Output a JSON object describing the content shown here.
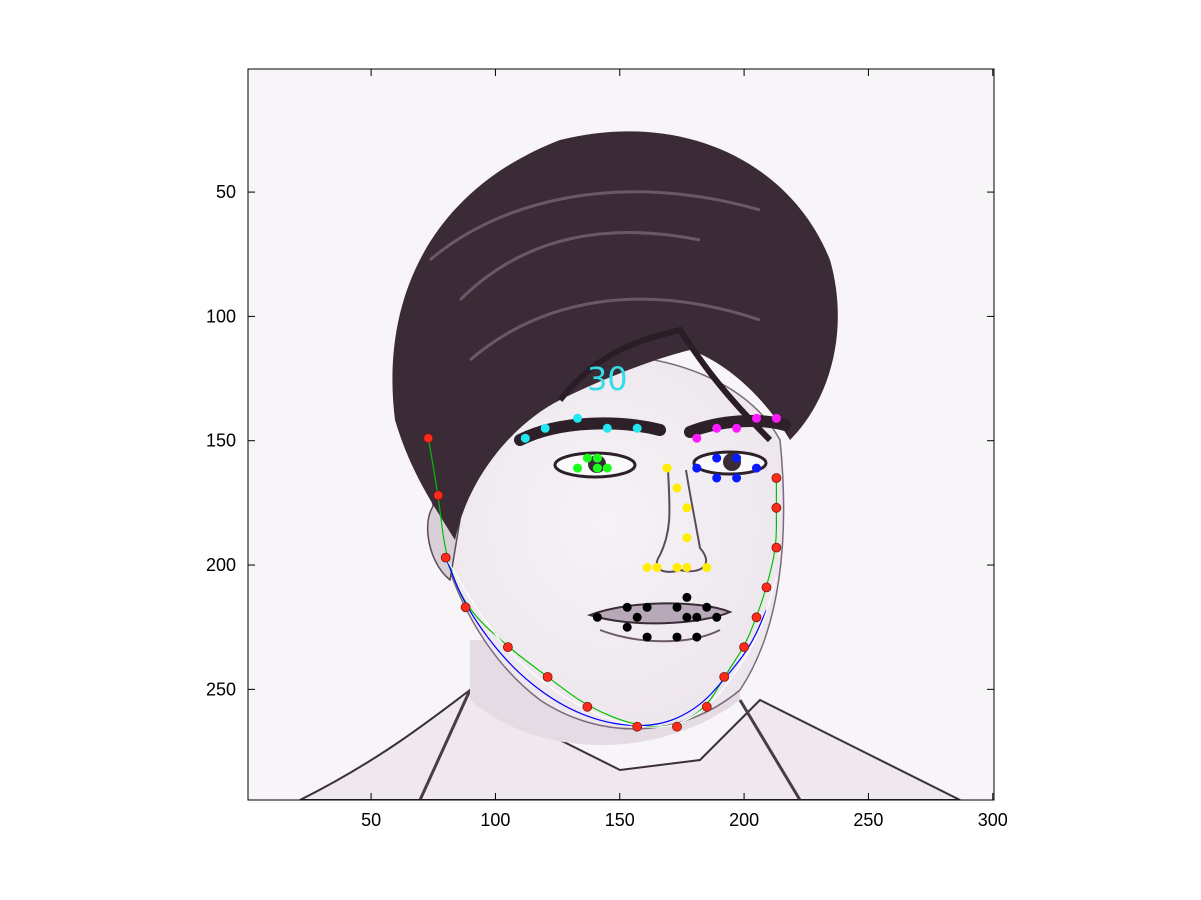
{
  "chart_data": {
    "type": "scatter",
    "title": "",
    "xlabel": "",
    "ylabel": "",
    "xlim": [
      0.5,
      300.5
    ],
    "ylim": [
      0.5,
      294.5
    ],
    "y_reversed": true,
    "grid": false,
    "x_ticks": [
      50,
      100,
      150,
      200,
      250,
      300
    ],
    "y_ticks": [
      50,
      100,
      150,
      200,
      250
    ],
    "background": "grayscale face sketch image",
    "annotations": [
      {
        "text": "30",
        "x": 145,
        "y": 126,
        "color": "#33dde6"
      }
    ],
    "series": [
      {
        "color": "#ff2a1a",
        "points": [
          [
            73,
            149
          ],
          [
            77,
            172
          ],
          [
            80,
            197
          ],
          [
            88,
            217
          ],
          [
            105,
            233
          ],
          [
            121,
            245
          ],
          [
            137,
            257
          ],
          [
            157,
            265
          ],
          [
            173,
            265
          ],
          [
            185,
            257
          ],
          [
            192,
            245
          ],
          [
            200,
            233
          ],
          [
            205,
            221
          ],
          [
            209,
            209
          ],
          [
            213,
            193
          ],
          [
            213,
            177
          ],
          [
            213,
            165
          ]
        ]
      },
      {
        "color": "#22e6f0",
        "points": [
          [
            112,
            149
          ],
          [
            120,
            145
          ],
          [
            133,
            141
          ],
          [
            145,
            145
          ],
          [
            157,
            145
          ]
        ]
      },
      {
        "color": "#ff1aff",
        "points": [
          [
            181,
            149
          ],
          [
            189,
            145
          ],
          [
            197,
            145
          ],
          [
            205,
            141
          ],
          [
            213,
            141
          ]
        ]
      },
      {
        "color": "#1aff1a",
        "points": [
          [
            133,
            161
          ],
          [
            137,
            157
          ],
          [
            141,
            157
          ],
          [
            141,
            161
          ],
          [
            145,
            161
          ]
        ]
      },
      {
        "color": "#0a1aff",
        "points": [
          [
            181,
            161
          ],
          [
            189,
            157
          ],
          [
            189,
            165
          ],
          [
            197,
            157
          ],
          [
            197,
            165
          ],
          [
            205,
            161
          ]
        ]
      },
      {
        "color": "#ffee00",
        "points": [
          [
            169,
            161
          ],
          [
            173,
            169
          ],
          [
            177,
            177
          ],
          [
            177,
            189
          ],
          [
            161,
            201
          ],
          [
            165,
            201
          ],
          [
            173,
            201
          ],
          [
            177,
            201
          ],
          [
            185,
            201
          ]
        ]
      },
      {
        "color": "#000000",
        "points": [
          [
            141,
            221
          ],
          [
            153,
            217
          ],
          [
            153,
            225
          ],
          [
            157,
            221
          ],
          [
            161,
            217
          ],
          [
            161,
            229
          ],
          [
            173,
            217
          ],
          [
            173,
            229
          ],
          [
            177,
            213
          ],
          [
            177,
            221
          ],
          [
            181,
            229
          ],
          [
            181,
            221
          ],
          [
            185,
            217
          ],
          [
            189,
            221
          ]
        ]
      }
    ],
    "curves": [
      {
        "color": "#00c000",
        "points": [
          [
            73,
            149
          ],
          [
            77,
            172
          ],
          [
            80,
            197
          ],
          [
            88,
            217
          ],
          [
            105,
            233
          ],
          [
            121,
            245
          ],
          [
            137,
            257
          ],
          [
            157,
            265
          ],
          [
            173,
            265
          ],
          [
            185,
            257
          ],
          [
            192,
            245
          ],
          [
            200,
            233
          ],
          [
            205,
            221
          ],
          [
            209,
            209
          ],
          [
            213,
            193
          ],
          [
            213,
            177
          ],
          [
            213,
            165
          ]
        ]
      },
      {
        "color": "#0000ff",
        "points": [
          [
            80,
            197
          ],
          [
            88,
            217
          ],
          [
            105,
            240
          ],
          [
            125,
            256
          ],
          [
            145,
            264
          ],
          [
            165,
            265
          ],
          [
            181,
            258
          ],
          [
            193,
            245
          ],
          [
            203,
            232
          ],
          [
            209,
            218
          ]
        ]
      },
      {
        "color": "#ffffff",
        "points": [
          [
            80,
            197
          ],
          [
            95,
            222
          ],
          [
            110,
            240
          ],
          [
            130,
            255
          ],
          [
            150,
            264
          ],
          [
            170,
            266
          ],
          [
            185,
            258
          ],
          [
            197,
            243
          ],
          [
            207,
            226
          ],
          [
            213,
            205
          ]
        ]
      }
    ]
  }
}
